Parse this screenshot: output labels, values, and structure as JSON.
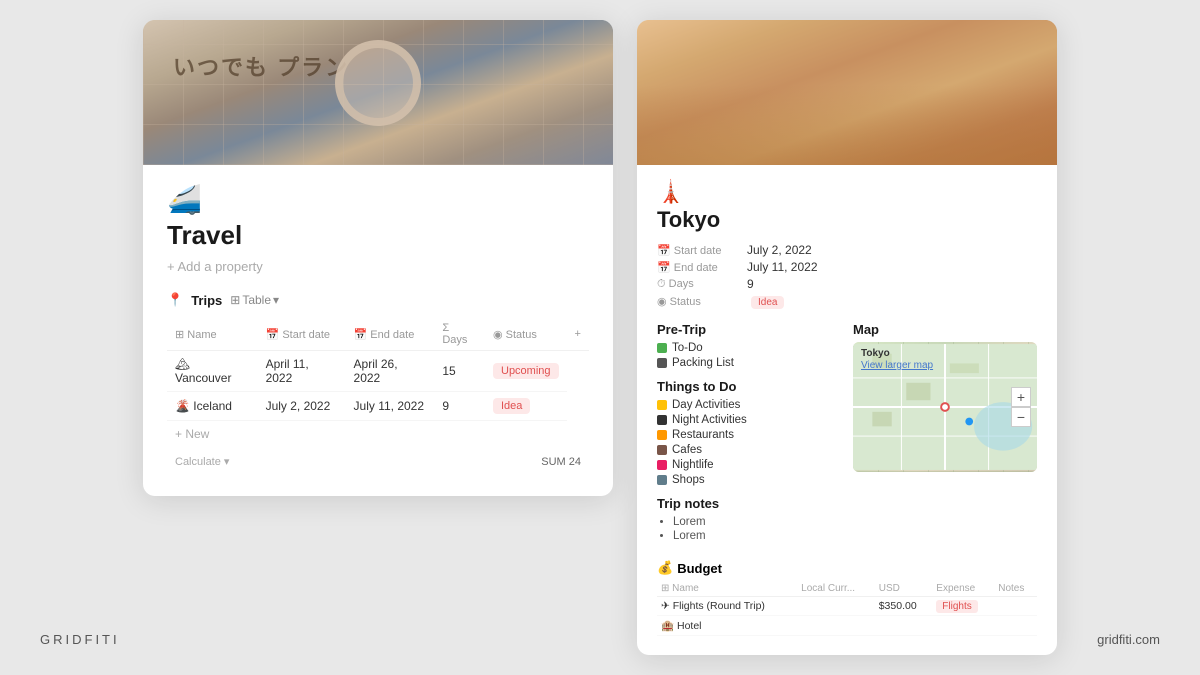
{
  "branding": {
    "left": "GRIDFITI",
    "right": "gridfiti.com"
  },
  "left_card": {
    "emoji": "🚄",
    "title": "Travel",
    "add_property": "+ Add a property",
    "section_icon": "📍",
    "section_label": "Trips",
    "view_icon": "⊞",
    "view_label": "Table",
    "table": {
      "headers": [
        "Name",
        "Start date",
        "End date",
        "Days",
        "Status",
        "+"
      ],
      "rows": [
        {
          "name": "🏔 Vancouver",
          "start": "April 11, 2022",
          "end": "April 26, 2022",
          "days": "15",
          "status": "Upcoming",
          "status_type": "upcoming"
        },
        {
          "name": "🌋 Iceland",
          "start": "July 2, 2022",
          "end": "July 11, 2022",
          "days": "9",
          "status": "Idea",
          "status_type": "idea"
        }
      ],
      "calculate_label": "Calculate",
      "sum_label": "SUM",
      "sum_value": "24"
    }
  },
  "right_card": {
    "emoji": "🗼",
    "title": "Tokyo",
    "meta": [
      {
        "icon": "📅",
        "key": "Start date",
        "value": "July 2, 2022"
      },
      {
        "icon": "📅",
        "key": "End date",
        "value": "July 11, 2022"
      },
      {
        "icon": "⏱",
        "key": "Days",
        "value": "9"
      },
      {
        "icon": "⊙",
        "key": "Status",
        "value": "Idea",
        "badge": true
      }
    ],
    "pre_trip": {
      "title": "Pre-Trip",
      "items": [
        {
          "color": "#4CAF50",
          "label": "To-Do"
        },
        {
          "color": "#555",
          "label": "Packing List"
        }
      ]
    },
    "things_to_do": {
      "title": "Things to Do",
      "items": [
        {
          "color": "#FFC107",
          "label": "Day Activities"
        },
        {
          "color": "#333",
          "label": "Night Activities"
        },
        {
          "color": "#FF9800",
          "label": "Restaurants"
        },
        {
          "color": "#795548",
          "label": "Cafes"
        },
        {
          "color": "#E91E63",
          "label": "Nightlife"
        },
        {
          "color": "#607D8B",
          "label": "Shops"
        }
      ]
    },
    "map": {
      "title": "Map",
      "city_label": "Tokyo",
      "link_text": "View larger map",
      "zoom_in": "+",
      "zoom_out": "−"
    },
    "trip_notes": {
      "title": "Trip notes",
      "items": [
        "Lorem",
        "Lorem"
      ]
    },
    "budget": {
      "title": "Budget",
      "emoji": "💰",
      "headers": [
        "Name",
        "Local Curr...",
        "USD",
        "Expense",
        "Notes"
      ],
      "rows": [
        {
          "name": "✈ Flights (Round Trip)",
          "local": "",
          "usd": "$350.00",
          "expense": "Flights",
          "expense_type": "flights",
          "notes": ""
        },
        {
          "name": "🏨 Hotel",
          "local": "",
          "usd": "$...",
          "expense": "...",
          "expense_type": "other",
          "notes": ""
        }
      ]
    }
  }
}
